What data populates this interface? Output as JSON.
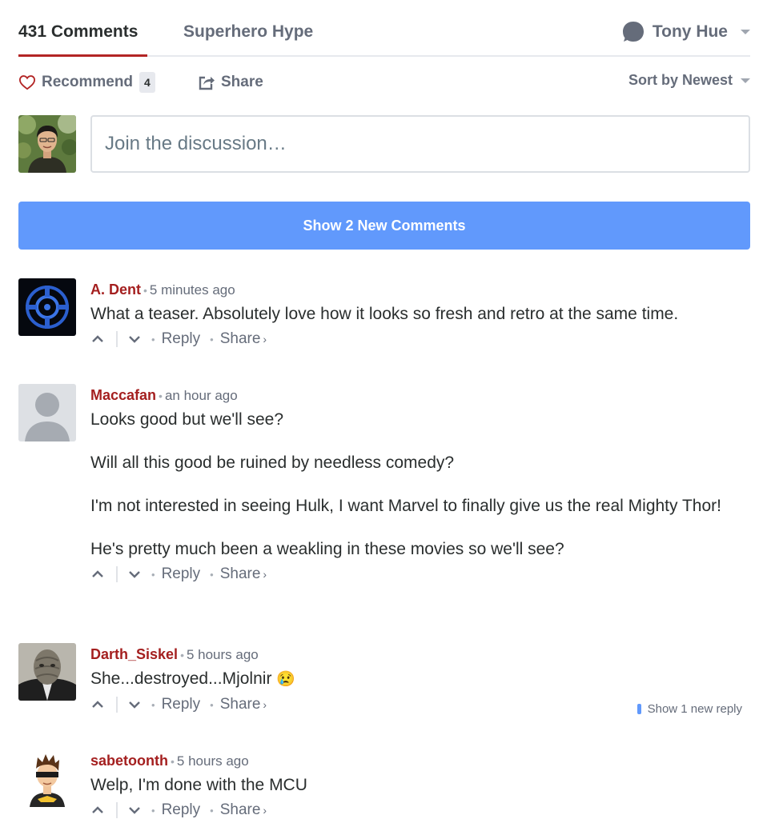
{
  "nav": {
    "comments_tab": "431 Comments",
    "community_tab": "Superhero Hype",
    "user_name": "Tony Hue"
  },
  "actions": {
    "recommend_label": "Recommend",
    "recommend_count": "4",
    "share_label": "Share",
    "sort_label": "Sort by Newest"
  },
  "compose": {
    "placeholder": "Join the discussion…"
  },
  "new_comments_button": "Show 2 New Comments",
  "comment_footer": {
    "reply": "Reply",
    "share": "Share",
    "share_arrow": "›"
  },
  "comments": [
    {
      "author": "A. Dent",
      "time": "5 minutes ago",
      "paragraphs": [
        "What a teaser. Absolutely love how it looks so fresh and retro at the same time."
      ]
    },
    {
      "author": "Maccafan",
      "time": "an hour ago",
      "paragraphs": [
        "Looks good but we'll see?",
        "Will all this good be ruined by needless comedy?",
        "I'm not interested in seeing Hulk, I want Marvel to finally give us the real Mighty Thor!",
        "He's pretty much been a weakling in these movies so we'll see?"
      ]
    },
    {
      "author": "Darth_Siskel",
      "time": "5 hours ago",
      "paragraphs": [
        "She...destroyed...Mjolnir"
      ],
      "emoji": "😢",
      "new_reply": "Show 1 new reply"
    },
    {
      "author": "sabetoonth",
      "time": "5 hours ago",
      "paragraphs": [
        "Welp, I'm done with the MCU"
      ]
    }
  ],
  "colors": {
    "accent_red": "#b32525",
    "author_red": "#a41f1f",
    "button_blue": "#6199fc",
    "muted_text": "#656c7a"
  }
}
